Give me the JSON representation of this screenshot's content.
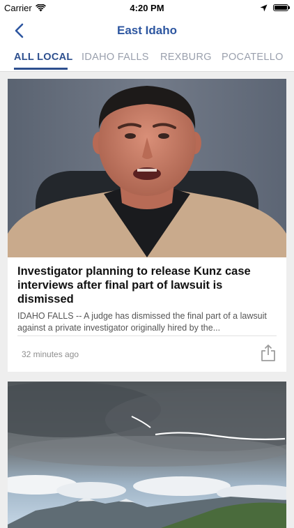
{
  "status_bar": {
    "carrier": "Carrier",
    "time": "4:20 PM"
  },
  "nav": {
    "title": "East Idaho",
    "back_icon": "chevron-left-icon"
  },
  "tabs": [
    {
      "label": "ALL LOCAL",
      "active": true
    },
    {
      "label": "IDAHO FALLS",
      "active": false
    },
    {
      "label": "REXBURG",
      "active": false
    },
    {
      "label": "POCATELLO",
      "active": false
    }
  ],
  "articles": [
    {
      "headline": "Investigator planning to release Kunz case interviews after final part of lawsuit is dismissed",
      "summary": "IDAHO FALLS -- A judge has dismissed the final part of a lawsuit against a private investigator originally hired by the...",
      "time": "32 minutes ago",
      "share_icon": "share-icon"
    }
  ],
  "colors": {
    "nav_title": "#2d56a0",
    "tab_active": "#2d4f8e",
    "tab_inactive": "#9aa0ad",
    "background": "#eeeeee"
  }
}
